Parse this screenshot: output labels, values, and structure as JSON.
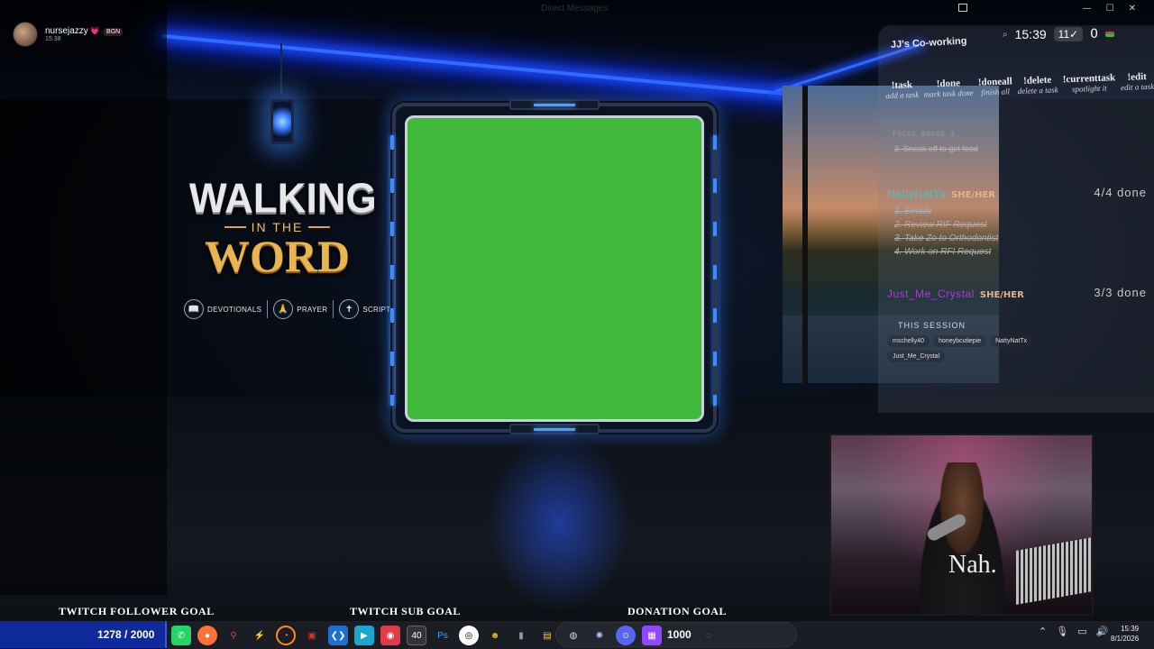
{
  "top_bar": {
    "direct_messages": "Direct Messages"
  },
  "profile": {
    "name": "nursejazzy",
    "heart": "💗",
    "badge": "BGN",
    "time": "15:38"
  },
  "overlay_title": {
    "line1": "WALKING",
    "line2": "IN THE",
    "line3": "WORD"
  },
  "categories": [
    {
      "label": "DEVOTIONALS",
      "icon": "open-book-icon"
    },
    {
      "label": "PRAYER",
      "icon": "praying-hands-icon"
    },
    {
      "label": "SCRIPTURE",
      "icon": "bible-icon"
    }
  ],
  "coworking": {
    "title": "JJ's Co-working",
    "commands": [
      {
        "name": "!task",
        "desc": "add a task"
      },
      {
        "name": "!done",
        "desc": "mark task done"
      },
      {
        "name": "!doneall",
        "desc": "finish all"
      },
      {
        "name": "!delete",
        "desc": "delete a task"
      },
      {
        "name": "!currenttask",
        "desc": "spotlight it"
      },
      {
        "name": "!edit",
        "desc": "edit a task"
      }
    ],
    "focus_board": "FOCUS BOARD 3",
    "focus_task": "2. Sneak off to get food",
    "users": [
      {
        "name": "NattyNatTx",
        "pronoun": "SHE/HER",
        "done": "4/4 done",
        "name_color": "#3ec7c7",
        "tasks": [
          "1. Emails",
          "2. Review RIF Request",
          "3. Take Zo to Orthodontist",
          "4. Work on RFI Request"
        ]
      },
      {
        "name": "Just_Me_Crystal",
        "pronoun": "SHE/HER",
        "done": "3/3 done",
        "name_color": "#b23ad6",
        "tasks": []
      }
    ],
    "session_label": "THIS SESSION",
    "session_users": [
      "mschelly40",
      "honeybcutiepie",
      "NattyNatTx",
      "Just_Me_Crystal"
    ]
  },
  "hud": {
    "time": "15:39",
    "checks": "11✓",
    "zero": "0"
  },
  "webcam": {
    "shirt_text": "Nah."
  },
  "goals": {
    "follower_label": "TWITCH FOLLOWER GOAL",
    "follower_progress": "1278 / 2000",
    "follower_current": 1278,
    "follower_target": 2000,
    "sub_label": "TWITCH SUB GOAL",
    "sub_value": "40",
    "donation_label": "DONATION GOAL",
    "donation_value": "1000"
  },
  "taskbar": {
    "clock_time": "15:39",
    "clock_date": "8/1/2026",
    "icons": [
      "whatsapp-icon",
      "firefox-icon",
      "search-tool-icon",
      "app-icon",
      "clock-app-icon",
      "red-app-icon",
      "vscode-icon",
      "media-icon",
      "streamlabs-icon",
      "ps-icon",
      "obs-icon",
      "app-icon-2",
      "app-icon-3",
      "explorer-icon",
      "chrome-icon",
      "app-icon-4",
      "discord-icon",
      "twitch-icon",
      "spotify-icon"
    ]
  },
  "colors": {
    "neon_blue": "#2f6bff",
    "green_screen": "#3fb93a",
    "goal_blue": "#0f2a9a",
    "gold": "#e8b54e"
  }
}
